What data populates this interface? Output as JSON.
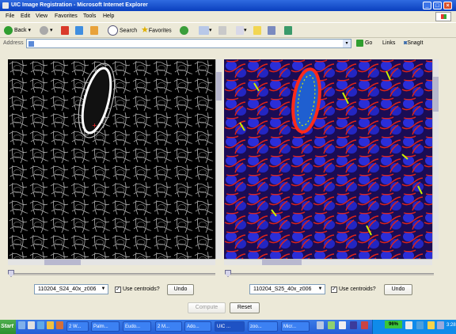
{
  "window": {
    "title": "UIC Image Registration - Microsoft Internet Explorer"
  },
  "menu": [
    "File",
    "Edit",
    "View",
    "Favorites",
    "Tools",
    "Help"
  ],
  "toolbar": {
    "back": "Back",
    "search": "Search",
    "favorites": "Favorites"
  },
  "address": {
    "label": "Address",
    "value": "",
    "go": "Go",
    "links": "Links",
    "snagit": "SnagIt"
  },
  "left_panel": {
    "select_value": "110204_S24_40x_z006",
    "use_centroids_label": "Use centroids?",
    "use_centroids_checked": true,
    "undo": "Undo"
  },
  "right_panel": {
    "select_value": "110204_S25_40x_z006",
    "use_centroids_label": "Use centroids?",
    "use_centroids_checked": true,
    "undo": "Undo"
  },
  "actions": {
    "compute": "Compute",
    "reset": "Reset"
  },
  "taskbar": {
    "start": "Start",
    "tasks": [
      "2 W...",
      "Palm...",
      "Eudo...",
      "2 M...",
      "Ado...",
      "UIC ...",
      "zoo...",
      "Micr..."
    ],
    "battery": "96%",
    "clock": "3:28"
  },
  "colors": {
    "titlebar": "#0a3fbe",
    "taskbar": "#245ed6",
    "chrome": "#ece9d8"
  }
}
